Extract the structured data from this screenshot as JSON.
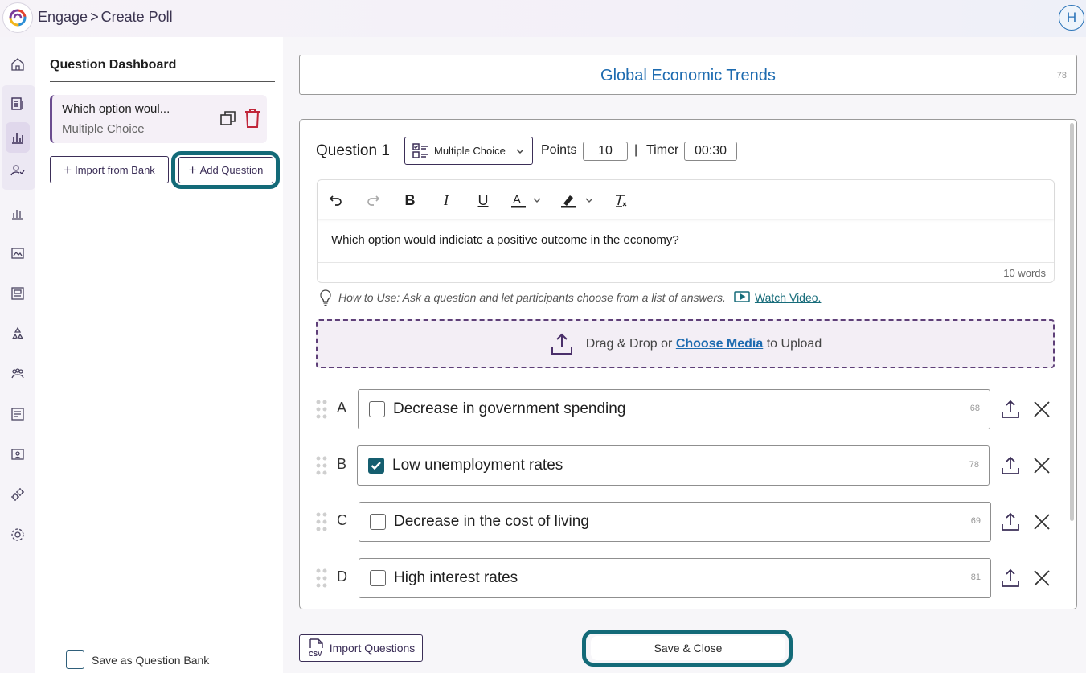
{
  "header": {
    "app_name": "Engage",
    "separator": ">",
    "page_title": "Create Poll",
    "avatar_initial": "H"
  },
  "rail": {
    "icons": [
      "home-icon",
      "document-icon",
      "poll-icon",
      "users-check-icon",
      "bar-chart-icon",
      "image-icon",
      "newspaper-icon",
      "recycle-icon",
      "group-icon",
      "list-icon",
      "badge-icon",
      "gears-icon",
      "settings-icon"
    ]
  },
  "dashboard": {
    "title": "Question Dashboard",
    "questions": [
      {
        "text": "Which option woul...",
        "type": "Multiple Choice"
      }
    ],
    "import_bank_label": "Import from Bank",
    "add_question_label": "Add Question",
    "save_bank_label": "Save as Question Bank"
  },
  "poll": {
    "title": "Global Economic Trends",
    "title_count": "78"
  },
  "question": {
    "label": "Question 1",
    "type": "Multiple Choice",
    "points_label": "Points",
    "points": "10",
    "separator": "|",
    "timer_label": "Timer",
    "timer": "00:30",
    "text": "Which option would indiciate a positive outcome in the economy?",
    "word_count": "10 words",
    "howto": "How to Use: Ask a question and let participants choose from a list of answers.",
    "watch_video": "Watch Video.",
    "drop_prefix": "Drag & Drop or",
    "drop_link": "Choose Media",
    "drop_suffix": "to Upload"
  },
  "options": [
    {
      "letter": "A",
      "text": "Decrease in government spending",
      "count": "68",
      "checked": false
    },
    {
      "letter": "B",
      "text": "Low unemployment rates",
      "count": "78",
      "checked": true
    },
    {
      "letter": "C",
      "text": "Decrease in the cost of living",
      "count": "69",
      "checked": false
    },
    {
      "letter": "D",
      "text": "High interest rates",
      "count": "81",
      "checked": false
    }
  ],
  "footer": {
    "import_questions_label": "Import Questions",
    "save_close_label": "Save & Close",
    "csv_badge": "CSV"
  },
  "colors": {
    "accent_teal": "#136a78",
    "brand_purple": "#3b2e57",
    "link_blue": "#1d6bb0",
    "delete_red": "#c0263a"
  }
}
